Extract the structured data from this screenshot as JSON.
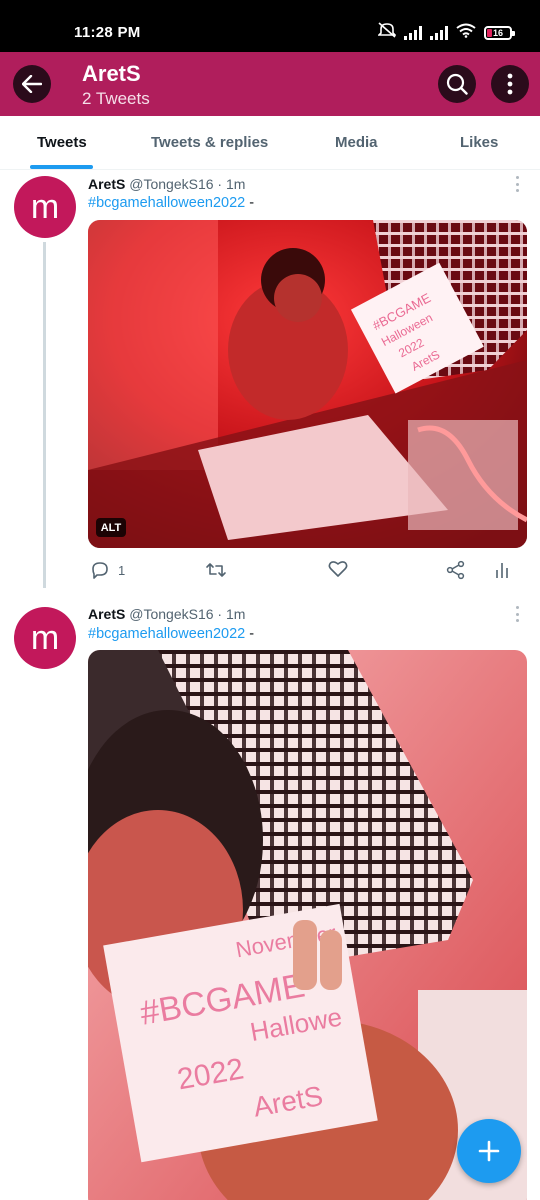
{
  "status_bar": {
    "time": "11:28 PM",
    "battery": "16"
  },
  "header": {
    "title": "AretS",
    "subtitle": "2 Tweets",
    "brand_color": "#b01e5c"
  },
  "tabs": [
    {
      "label": "Tweets",
      "active": true
    },
    {
      "label": "Tweets & replies",
      "active": false
    },
    {
      "label": "Media",
      "active": false
    },
    {
      "label": "Likes",
      "active": false
    }
  ],
  "tweets": [
    {
      "avatar_letter": "m",
      "name": "AretS",
      "handle": "@TongekS16",
      "time": "· 1m",
      "hashtag": "#bcgamehalloween2022",
      "suffix": " -",
      "alt_badge": "ALT",
      "reply_count": "1"
    },
    {
      "avatar_letter": "m",
      "name": "AretS",
      "handle": "@TongekS16",
      "time": "· 1m",
      "hashtag": "#bcgamehalloween2022",
      "suffix": " -"
    }
  ],
  "photo1_sign": [
    "#BCGAME",
    "Halloween",
    "2022",
    "AretS"
  ],
  "photo2_sign": [
    "November",
    "#BCGAME",
    "Hallowe",
    "2022",
    "AretS"
  ],
  "colors": {
    "accent": "#1d9bf0",
    "avatar": "#c2185b"
  }
}
